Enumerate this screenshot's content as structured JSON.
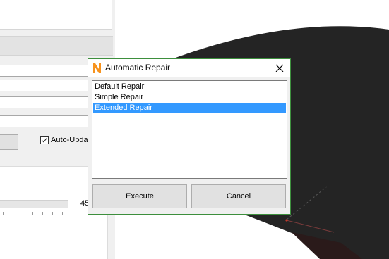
{
  "background_panel": {
    "checkbox_label": "Auto-Updat",
    "checkbox_checked": true,
    "slider_value": "45"
  },
  "dialog": {
    "icon": "n-app-icon",
    "title": "Automatic Repair",
    "close_icon": "close-icon",
    "list_items": [
      "Default Repair",
      "Simple Repair",
      "Extended Repair"
    ],
    "selected_index": 2,
    "execute_label": "Execute",
    "cancel_label": "Cancel",
    "colors": {
      "border": "#3d8f3d",
      "selection": "#3399ff",
      "icon_orange": "#f7931e"
    }
  }
}
